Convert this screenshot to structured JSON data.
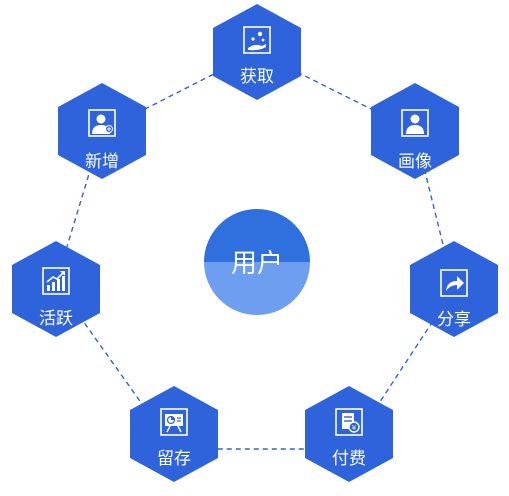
{
  "diagram": {
    "center": {
      "label": "用户",
      "colors": {
        "top": "#2f6fde",
        "bottom": "#6e9ef0"
      }
    },
    "hex_color": "#2e63dc",
    "connector_color": "#2e63dc",
    "nodes": [
      {
        "id": "acquire",
        "label": "获取",
        "icon": "user-acquire-icon"
      },
      {
        "id": "portrait",
        "label": "画像",
        "icon": "user-portrait-icon"
      },
      {
        "id": "share",
        "label": "分享",
        "icon": "share-arrow-icon"
      },
      {
        "id": "pay",
        "label": "付费",
        "icon": "invoice-yen-icon"
      },
      {
        "id": "retain",
        "label": "留存",
        "icon": "presentation-board-icon"
      },
      {
        "id": "active",
        "label": "活跃",
        "icon": "trend-chart-icon"
      },
      {
        "id": "grow",
        "label": "新增",
        "icon": "add-user-icon"
      }
    ]
  }
}
